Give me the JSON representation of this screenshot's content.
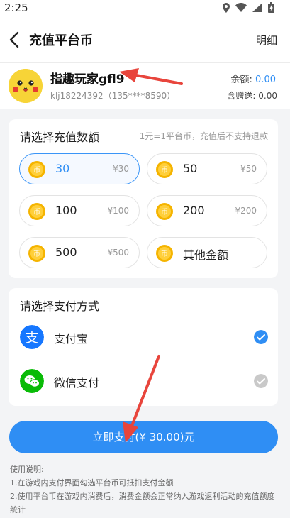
{
  "status": {
    "time": "2:25"
  },
  "nav": {
    "title": "充值平台币",
    "detail": "明细"
  },
  "user": {
    "name": "指趣玩家gfl9",
    "account": "klj18224392（135****8590）",
    "balance_label": "余额: ",
    "balance_value": "0.00",
    "gift": "含赠送: 0.00"
  },
  "recharge": {
    "heading": "请选择充值数额",
    "hint": "1元=1平台币，充值后不支持退款",
    "options": [
      {
        "amount": "30",
        "price": "¥30",
        "selected": true
      },
      {
        "amount": "50",
        "price": "¥50"
      },
      {
        "amount": "100",
        "price": "¥100"
      },
      {
        "amount": "200",
        "price": "¥200"
      },
      {
        "amount": "500",
        "price": "¥500"
      },
      {
        "amount": "其他金额",
        "price": ""
      }
    ]
  },
  "payment": {
    "heading": "请选择支付方式",
    "methods": [
      {
        "label": "支付宝",
        "icon": "alipay-icon",
        "color": "#1677ff",
        "checked": true
      },
      {
        "label": "微信支付",
        "icon": "wechat-icon",
        "color": "#09bb07",
        "checked": false
      }
    ]
  },
  "pay_button": "立即支付(¥ 30.00)元",
  "notes": {
    "title": "使用说明:",
    "lines": [
      "1.在游戏内支付界面勾选平台币可抵扣支付金额",
      "2.使用平台币在游戏内消费后，消费金额会正常纳入游戏返利活动的充值额度统计"
    ]
  },
  "colors": {
    "accent": "#2f8ef4",
    "coin": "#f5b400",
    "arrow": "#e8453c"
  }
}
